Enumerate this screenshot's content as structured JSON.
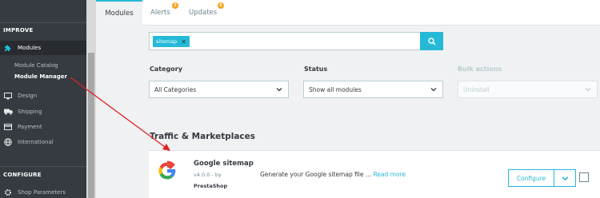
{
  "sidebar": {
    "improve_label": "IMPROVE",
    "modules_label": "Modules",
    "module_catalog_label": "Module Catalog",
    "module_manager_label": "Module Manager",
    "design_label": "Design",
    "shipping_label": "Shipping",
    "payment_label": "Payment",
    "international_label": "International",
    "configure_label": "CONFIGURE",
    "shop_parameters_label": "Shop Parameters"
  },
  "tabs": {
    "modules_label": "Modules",
    "alerts_label": "Alerts",
    "alerts_badge": "2",
    "updates_label": "Updates",
    "updates_badge": "6"
  },
  "search": {
    "tag_label": "sitemap"
  },
  "filters": {
    "category_label": "Category",
    "category_value": "All Categories",
    "status_label": "Status",
    "status_value": "Show all modules",
    "bulk_label": "Bulk actions",
    "bulk_value": "Uninstall"
  },
  "section": {
    "title": "Traffic & Marketplaces"
  },
  "module": {
    "name": "Google sitemap",
    "version": "v4.0.0 - by",
    "author": "PrestaShop",
    "description": "Generate your Google sitemap file ...",
    "read_more": "Read more",
    "configure_label": "Configure"
  },
  "colors": {
    "accent": "#25b9d7",
    "sidebar_bg": "#363a41",
    "badge": "#f6a31d",
    "arrow": "#e02020"
  },
  "icons": [
    "puzzle-icon",
    "monitor-icon",
    "truck-icon",
    "credit-card-icon",
    "globe-icon",
    "gears-icon",
    "search-icon",
    "chevron-down-icon",
    "google-logo"
  ]
}
